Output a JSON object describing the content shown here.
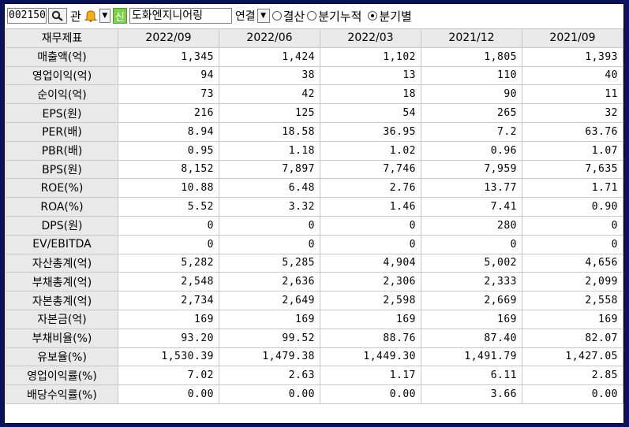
{
  "toolbar": {
    "stock_code": "002150",
    "gwan_label": "관",
    "new_badge": "신",
    "company_name": "도화엔지니어링",
    "consolidation": "연결",
    "radio_options": [
      {
        "label": "결산",
        "selected": false
      },
      {
        "label": "분기누적",
        "selected": false
      },
      {
        "label": "분기별",
        "selected": true
      }
    ]
  },
  "table": {
    "header_label": "재무제표",
    "periods": [
      "2022/09",
      "2022/06",
      "2022/03",
      "2021/12",
      "2021/09"
    ],
    "rows": [
      {
        "label": "매출액(억)",
        "values": [
          "1,345",
          "1,424",
          "1,102",
          "1,805",
          "1,393"
        ]
      },
      {
        "label": "영업이익(억)",
        "values": [
          "94",
          "38",
          "13",
          "110",
          "40"
        ]
      },
      {
        "label": "순이익(억)",
        "values": [
          "73",
          "42",
          "18",
          "90",
          "11"
        ]
      },
      {
        "label": "EPS(원)",
        "values": [
          "216",
          "125",
          "54",
          "265",
          "32"
        ]
      },
      {
        "label": "PER(배)",
        "values": [
          "8.94",
          "18.58",
          "36.95",
          "7.2",
          "63.76"
        ]
      },
      {
        "label": "PBR(배)",
        "values": [
          "0.95",
          "1.18",
          "1.02",
          "0.96",
          "1.07"
        ]
      },
      {
        "label": "BPS(원)",
        "values": [
          "8,152",
          "7,897",
          "7,746",
          "7,959",
          "7,635"
        ]
      },
      {
        "label": "ROE(%)",
        "values": [
          "10.88",
          "6.48",
          "2.76",
          "13.77",
          "1.71"
        ]
      },
      {
        "label": "ROA(%)",
        "values": [
          "5.52",
          "3.32",
          "1.46",
          "7.41",
          "0.90"
        ]
      },
      {
        "label": "DPS(원)",
        "values": [
          "0",
          "0",
          "0",
          "280",
          "0"
        ]
      },
      {
        "label": "EV/EBITDA",
        "values": [
          "0",
          "0",
          "0",
          "0",
          "0"
        ]
      },
      {
        "label": "자산총계(억)",
        "values": [
          "5,282",
          "5,285",
          "4,904",
          "5,002",
          "4,656"
        ]
      },
      {
        "label": "부채총계(억)",
        "values": [
          "2,548",
          "2,636",
          "2,306",
          "2,333",
          "2,099"
        ]
      },
      {
        "label": "자본총계(억)",
        "values": [
          "2,734",
          "2,649",
          "2,598",
          "2,669",
          "2,558"
        ]
      },
      {
        "label": "자본금(억)",
        "values": [
          "169",
          "169",
          "169",
          "169",
          "169"
        ]
      },
      {
        "label": "부채비율(%)",
        "values": [
          "93.20",
          "99.52",
          "88.76",
          "87.40",
          "82.07"
        ]
      },
      {
        "label": "유보율(%)",
        "values": [
          "1,530.39",
          "1,479.38",
          "1,449.30",
          "1,491.79",
          "1,427.05"
        ]
      },
      {
        "label": "영업이익률(%)",
        "values": [
          "7.02",
          "2.63",
          "1.17",
          "6.11",
          "2.85"
        ]
      },
      {
        "label": "배당수익률(%)",
        "values": [
          "0.00",
          "0.00",
          "0.00",
          "3.66",
          "0.00"
        ]
      }
    ]
  }
}
